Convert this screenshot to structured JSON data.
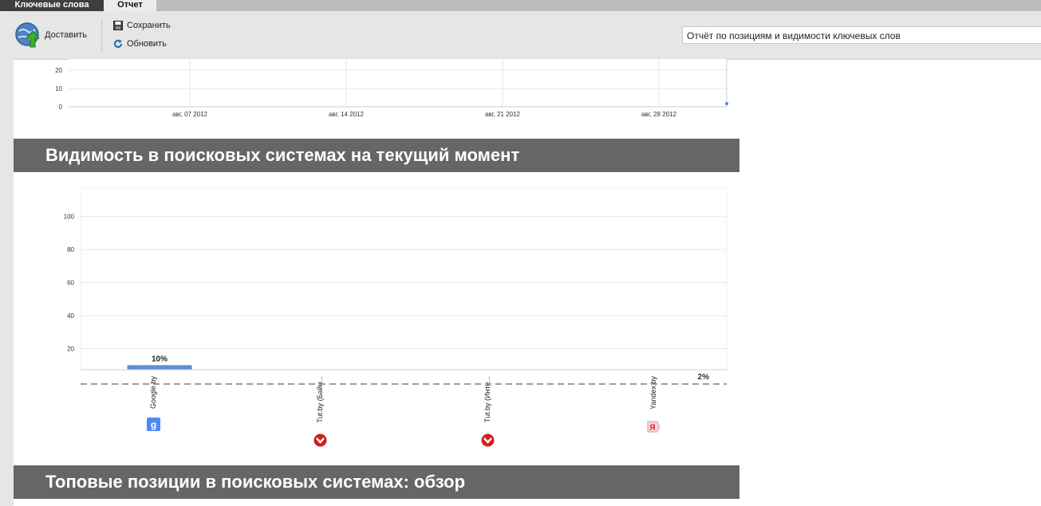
{
  "tabs": [
    {
      "label": "Ключевые слова",
      "active": false
    },
    {
      "label": "Отчет",
      "active": true
    }
  ],
  "toolbar": {
    "deliver_label": "Доставить",
    "save_label": "Сохранить",
    "refresh_label": "Обновить",
    "report_select_value": "Отчёт по позициям и видимости ключевых слов"
  },
  "sections": {
    "visibility_title": "Видимость в поисковых системах на текущий момент",
    "top_positions_title": "Топовые позиции в поисковых системах: обзор"
  },
  "chart_data": [
    {
      "type": "line",
      "x_ticks": [
        "авг, 07 2012",
        "авг, 14 2012",
        "авг, 21 2012",
        "авг, 28 2012"
      ],
      "y_ticks": [
        0,
        10,
        20
      ],
      "grid": true
    },
    {
      "type": "bar",
      "categories": [
        "Google.by",
        "Tut.by (Байн...",
        "Tut.by (Инте...",
        "Yandex.by"
      ],
      "values": [
        10,
        0,
        0,
        0
      ],
      "data_labels": [
        "10%",
        "",
        "",
        ""
      ],
      "y_ticks": [
        20,
        40,
        60,
        80,
        100
      ],
      "ylim": [
        0,
        110
      ],
      "reference_line": {
        "value": 2,
        "label": "2%",
        "style": "dashed"
      },
      "bar_color": "#5b8fd6",
      "grid": true,
      "category_icons": [
        "google-icon",
        "tutby-icon",
        "tutby-icon",
        "yandex-icon"
      ]
    }
  ]
}
